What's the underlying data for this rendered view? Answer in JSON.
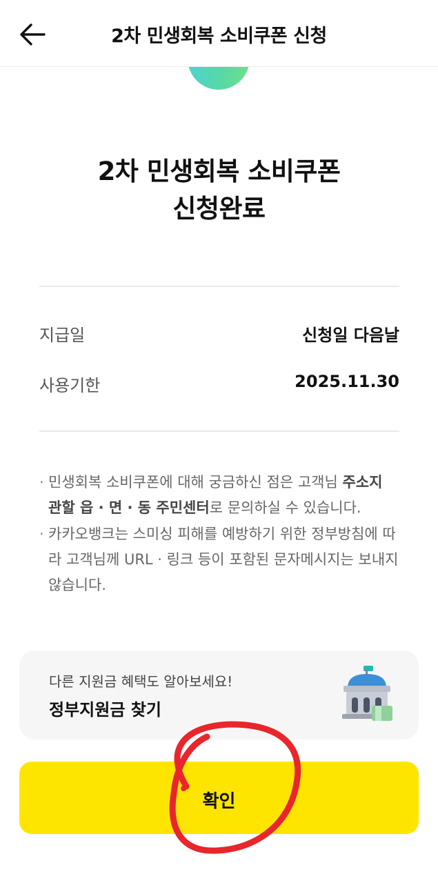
{
  "header": {
    "title": "2차 민생회복 소비쿠폰 신청",
    "back_icon": "arrow-left-icon"
  },
  "result": {
    "title_line1": "2차 민생회복 소비쿠폰",
    "title_line2": "신청완료"
  },
  "info": [
    {
      "label": "지급일",
      "value": "신청일 다음날"
    },
    {
      "label": "사용기한",
      "value": "2025.11.30"
    }
  ],
  "notices": [
    {
      "bullet": "·",
      "pre": "민생회복 소비쿠폰에 대해 궁금하신 점은 고객님 ",
      "bold": "주소지 관할 읍 · 면 · 동 주민센터",
      "post": "로 문의하실 수 있습니다."
    },
    {
      "bullet": "·",
      "text": "카카오뱅크는 스미싱 피해를 예방하기 위한 정부방침에 따라 고객님께 URL · 링크 등이 포함된 문자메시지는 보내지 않습니다."
    }
  ],
  "support_card": {
    "subtitle": "다른 지원금 혜택도 알아보세요!",
    "title": "정부지원금 찾기",
    "icon": "government-building-money-icon"
  },
  "confirm_button": {
    "label": "확인"
  },
  "colors": {
    "accent_yellow": "#fee500",
    "card_bg": "#f6f6f6",
    "annotation_red": "#e8262b",
    "circle_teal": "#4fd3d0",
    "circle_green": "#6fe08c"
  }
}
